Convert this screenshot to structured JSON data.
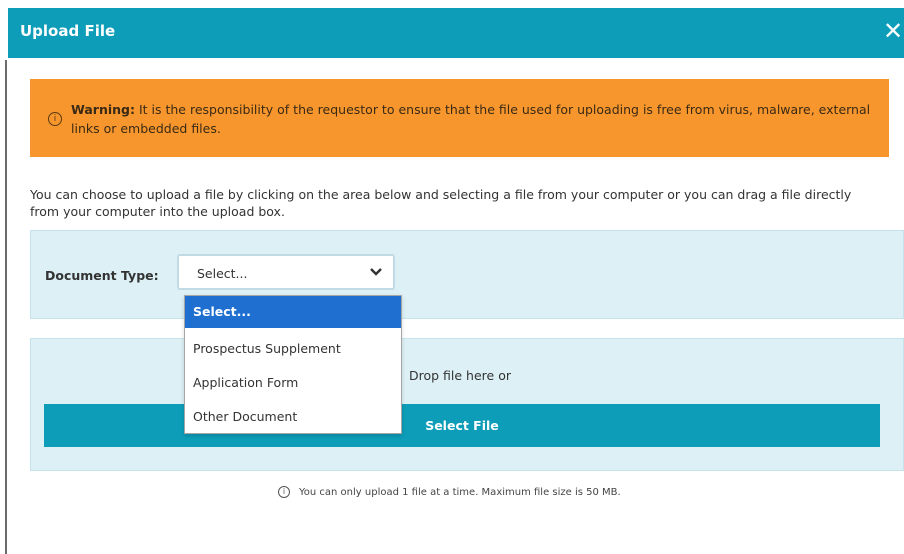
{
  "dialog": {
    "title": "Upload File",
    "close_icon": "close-icon"
  },
  "warning": {
    "icon": "info-icon",
    "label": "Warning:",
    "text": " It is the responsibility of the requestor to ensure that the file used for uploading is free from virus, malware, external links or embedded files."
  },
  "intro_text": "You can choose to upload a file by clicking on the area below and selecting a file from your computer or you can drag a file directly from your computer into the upload box.",
  "document_type": {
    "label": "Document Type:",
    "selected": "Select...",
    "options": [
      "Select...",
      "Prospectus Supplement",
      "Application Form",
      "Other Document"
    ]
  },
  "upload": {
    "drop_text": "Drop file here or",
    "button_label": "Select File"
  },
  "footer_note": "You can only upload 1 file at a time. Maximum file size is 50 MB.",
  "colors": {
    "header": "#0d9db8",
    "warning": "#f7962d",
    "panel": "#dcf0f5",
    "selected_option": "#1f6fd1"
  }
}
